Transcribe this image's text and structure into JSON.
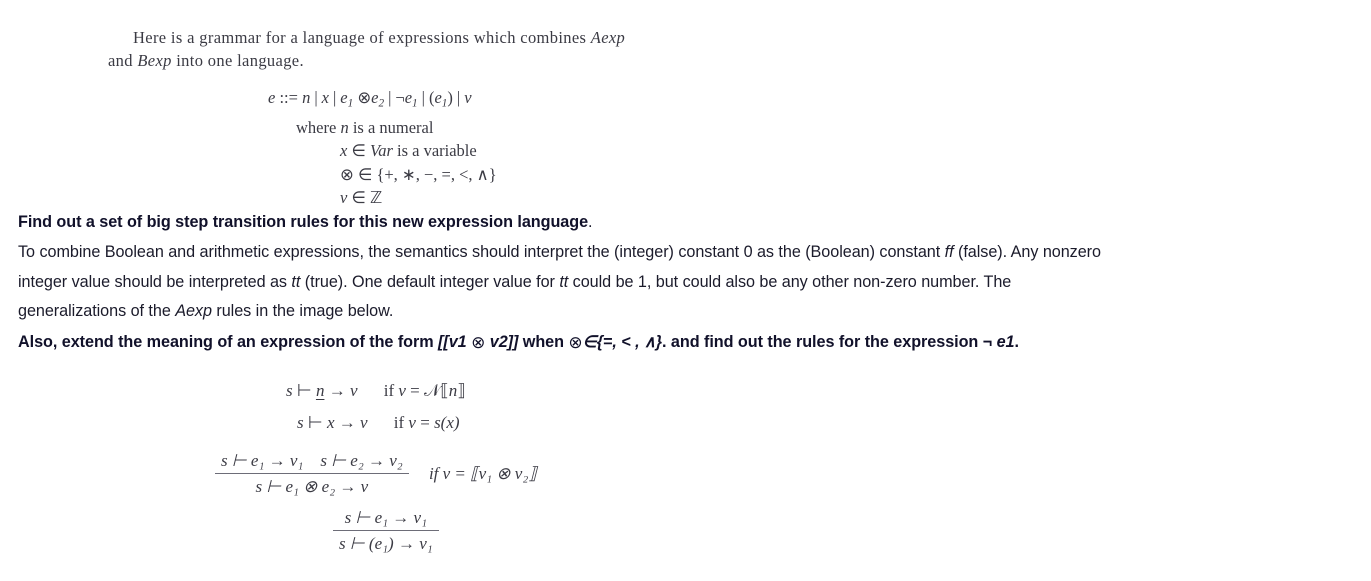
{
  "grammar_image": {
    "intro_line_1": "Here is a grammar for a language of expressions which combines ",
    "intro_aexp": "Aexp",
    "intro_line_2_pre": "and ",
    "intro_bexp": "Bexp",
    "intro_line_2_post": " into one language.",
    "production": "e ::= n | x | e₁ ⊗ e₂ | ¬e₁ | (e₁) | v",
    "where_numeral": "where n is a numeral",
    "where_var": "x ∈ Var is a variable",
    "where_op": "⊗ ∈ {+, ∗, −, =, <, ∧}",
    "where_val": "v ∈ ℤ",
    "production_parts": {
      "e": "e",
      "assign": "::=",
      "n": "n",
      "x": "x",
      "e1": "e",
      "sub1": "1",
      "otimes": "⊗",
      "e2": "e",
      "sub2": "2",
      "neg": "¬",
      "paren_open": "(",
      "paren_close": ")",
      "v": "v",
      "bar": "|"
    },
    "where_label": "where",
    "numeral_text": "is a numeral",
    "var_symbol": "Var",
    "var_text": "is a variable",
    "in_symbol": "∈",
    "op_set": "{+, ∗, −, =, <, ∧}",
    "int_symbol": "ℤ"
  },
  "prose": {
    "question_bold": "Find out a set of big step transition rules for this new expression language",
    "question_period": ".",
    "para_1a": "To combine Boolean and arithmetic expressions, the semantics should interpret the (integer) constant 0 as the (Boolean) constant ",
    "para_ff": "ff",
    "para_1b": " (false). Any nonzero",
    "para_2a": "integer value should be interpreted as ",
    "para_tt1": "tt",
    "para_2b": " (true). One default integer value for ",
    "para_tt2": "tt",
    "para_2c": " could be 1, but could also be any other non-zero number. The",
    "para_3a": "generalizations of the ",
    "para_aexp": "Aexp",
    "para_3b": " rules in the image below.",
    "also_1": "Also, extend the meaning of an expression of the form ",
    "also_expr": "[[v1 ",
    "also_otimes_1": "⊗",
    "also_expr_2": " v2]]",
    "also_2": " when ",
    "also_otimes_2": "⊗",
    "also_in": "∈",
    "also_set": "{=, < , ∧}",
    "also_3": ". and find out the rules for the expression ",
    "also_neg": "¬",
    "also_e1": " e1",
    "also_period": "."
  },
  "rules_image": {
    "axiom_numeral": {
      "judgment_s": "s",
      "turnstile": "⊢",
      "term": "n",
      "arrow": "→",
      "result": "v",
      "condition_if": "if",
      "condition_v": "v",
      "condition_eq": "=",
      "condition_n": "𝒩",
      "condition_brackets_open": "⟦",
      "condition_inner": "n",
      "condition_brackets_close": "⟧"
    },
    "axiom_var": {
      "judgment_s": "s",
      "turnstile": "⊢",
      "term": "x",
      "arrow": "→",
      "result": "v",
      "condition_if": "if",
      "condition_v": "v",
      "condition_eq": "=",
      "condition_body": "s(x)"
    },
    "rule_binop": {
      "premise_1": "s ⊢ e₁ → v₁",
      "premise_2": "s ⊢ e₂ → v₂",
      "conclusion": "s ⊢ e₁ ⊗ e₂ → v",
      "condition": "if v = ⟦v₁ ⊗ v₂⟧"
    },
    "rule_paren": {
      "premise": "s ⊢ e₁ → v₁",
      "conclusion": "s ⊢ (e₁) → v₁"
    }
  },
  "colors": {
    "background": "#ffffff",
    "serif_text": "#3b3b44",
    "prose_text": "#1b1b2b",
    "bold_text": "#11112a",
    "rule_line": "#6d6d78"
  }
}
